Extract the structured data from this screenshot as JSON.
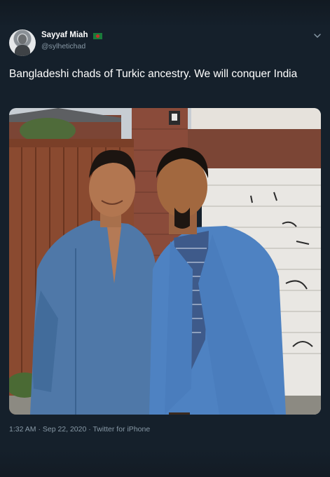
{
  "tweet": {
    "author_name": "Sayyaf Miah",
    "author_handle": "@sylhetichad",
    "flag_icon": "bangladesh-flag-icon",
    "text": "Bangladeshi chads of Turkic ancestry. We will conquer India",
    "timestamp": "1:32 AM · Sep 22, 2020 · Twitter for iPhone"
  },
  "colors": {
    "background": "#15202b",
    "text_primary": "#ffffff",
    "text_secondary": "#8899a6"
  }
}
